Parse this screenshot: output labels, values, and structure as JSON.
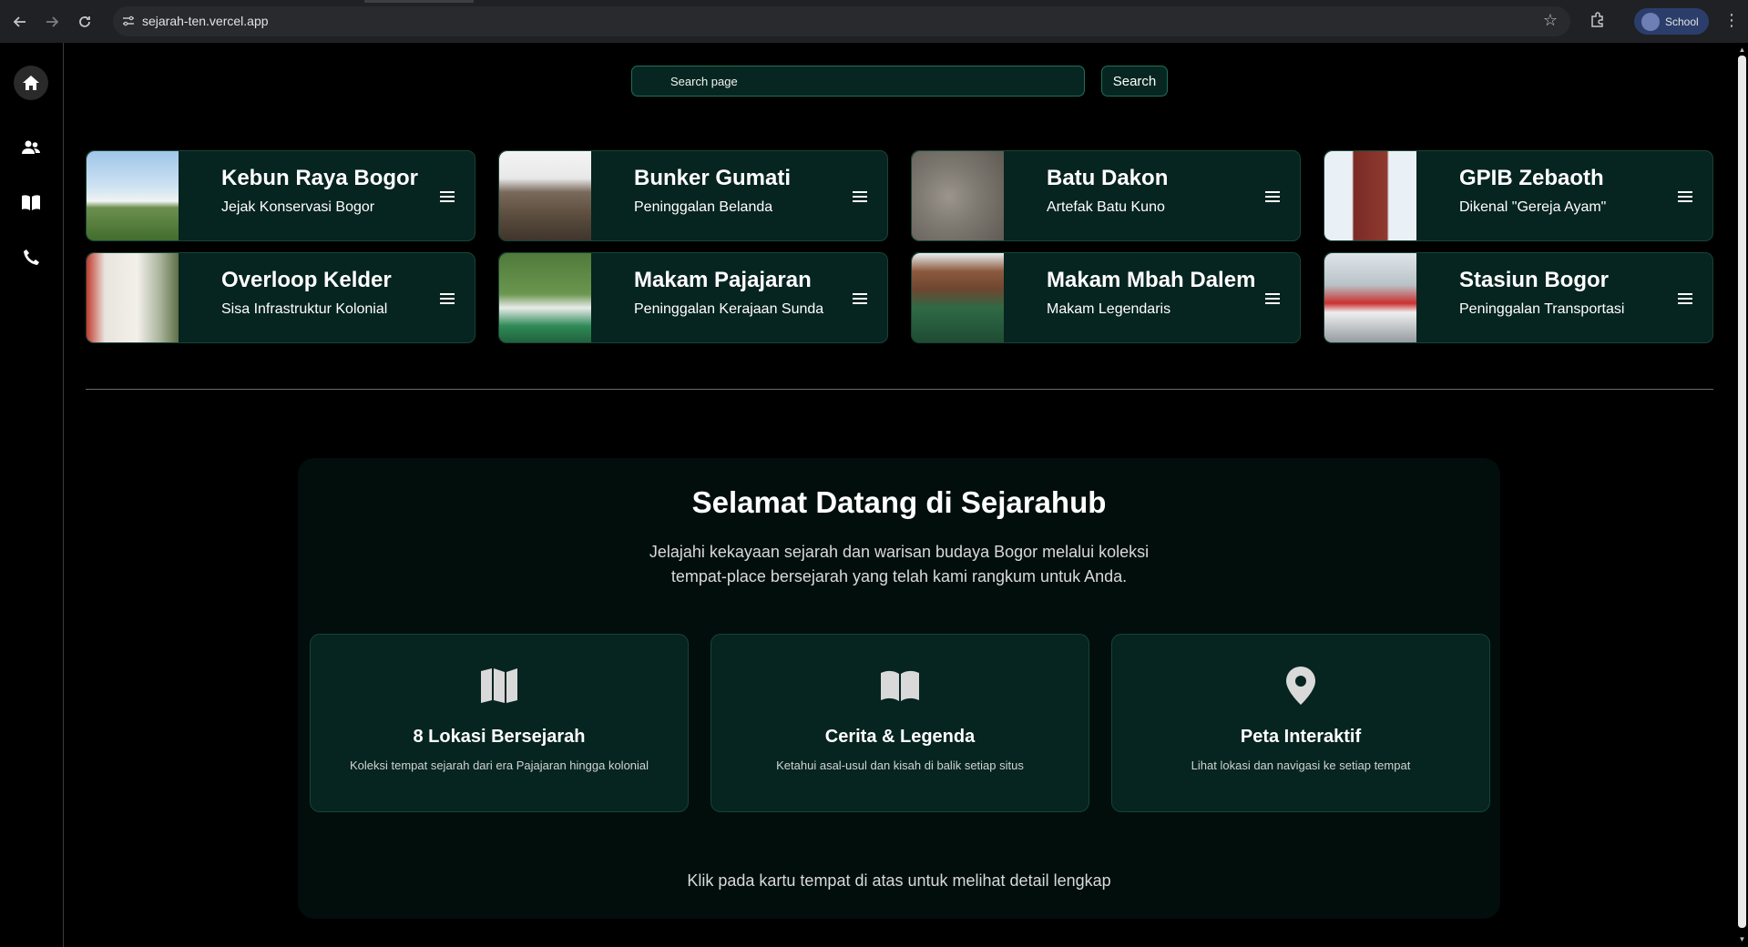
{
  "browser": {
    "url": "sejarah-ten.vercel.app",
    "profile_label": "School"
  },
  "search": {
    "placeholder": "Search page",
    "button_label": "Search"
  },
  "cards": [
    {
      "title": "Kebun Raya Bogor",
      "subtitle": "Jejak Konservasi Bogor"
    },
    {
      "title": "Bunker Gumati",
      "subtitle": "Peninggalan Belanda"
    },
    {
      "title": "Batu Dakon",
      "subtitle": "Artefak Batu Kuno"
    },
    {
      "title": "GPIB Zebaoth",
      "subtitle": "Dikenal \"Gereja Ayam\""
    },
    {
      "title": "Overloop Kelder",
      "subtitle": "Sisa Infrastruktur Kolonial"
    },
    {
      "title": "Makam Pajajaran",
      "subtitle": "Peninggalan Kerajaan Sunda"
    },
    {
      "title": "Makam Mbah Dalem",
      "subtitle": "Makam Legendaris"
    },
    {
      "title": "Stasiun Bogor",
      "subtitle": "Peninggalan Transportasi"
    }
  ],
  "welcome": {
    "title": "Selamat Datang di Sejarahub",
    "intro": "Jelajahi kekayaan sejarah dan warisan budaya Bogor melalui koleksi tempat-place bersejarah yang telah kami rangkum untuk Anda.",
    "features": [
      {
        "icon": "map-icon",
        "title": "8 Lokasi Bersejarah",
        "desc": "Koleksi tempat sejarah dari era Pajajaran hingga kolonial"
      },
      {
        "icon": "book-open-icon",
        "title": "Cerita & Legenda",
        "desc": "Ketahui asal-usul dan kisah di balik setiap situs"
      },
      {
        "icon": "map-pin-icon",
        "title": "Peta Interaktif",
        "desc": "Lihat lokasi dan navigasi ke setiap tempat"
      }
    ],
    "footnote": "Klik pada kartu tempat di atas untuk melihat detail lengkap"
  },
  "sidebar": {
    "items": [
      {
        "icon": "home-icon"
      },
      {
        "icon": "users-icon"
      },
      {
        "icon": "book-icon"
      },
      {
        "icon": "phone-icon"
      }
    ]
  },
  "colors": {
    "card_bg": "#062420",
    "card_border": "#174436",
    "page_bg": "#000000",
    "panel_bg": "#010e0c"
  }
}
